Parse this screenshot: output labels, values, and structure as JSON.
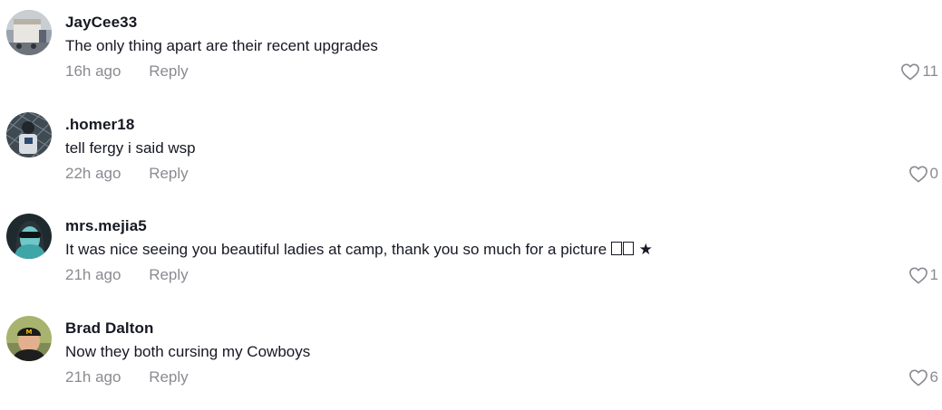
{
  "comments": [
    {
      "username": "JayCee33",
      "text": "The only thing apart are their recent upgrades",
      "time": "16h ago",
      "reply_label": "Reply",
      "likes": "11"
    },
    {
      "username": ".homer18",
      "text": "tell fergy i said wsp",
      "time": "22h ago",
      "reply_label": "Reply",
      "likes": "0"
    },
    {
      "username": "mrs.mejia5",
      "text": "It was nice seeing you beautiful ladies at camp, thank you so much for a picture",
      "text_suffix": " ★",
      "time": "21h ago",
      "reply_label": "Reply",
      "likes": "1"
    },
    {
      "username": "Brad Dalton",
      "text": "Now they both cursing my Cowboys",
      "time": "21h ago",
      "reply_label": "Reply",
      "likes": "6"
    }
  ],
  "colors": {
    "primary_text": "#161823",
    "secondary_text": "#8a8b91",
    "background": "#ffffff"
  },
  "icons": {
    "like": "heart-outline-icon"
  }
}
